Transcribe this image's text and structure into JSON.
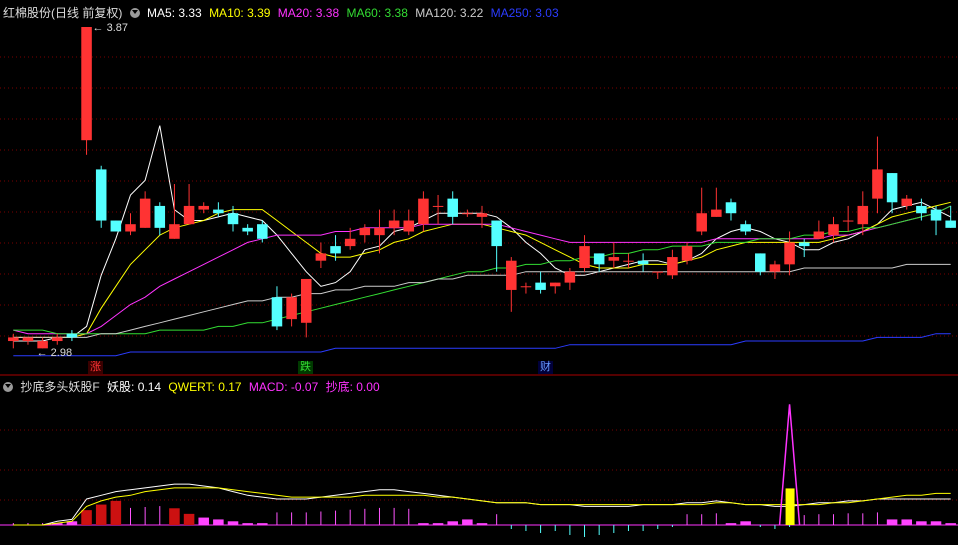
{
  "main_panel": {
    "indicator_icon": "chevron-down-circle-icon",
    "stock_title": "红棉股份(日线 前复权)",
    "ma_legend": [
      {
        "label": "MA5: 3.33",
        "color": "#ffffff"
      },
      {
        "label": "MA10: 3.39",
        "color": "#ffff00"
      },
      {
        "label": "MA20: 3.38",
        "color": "#ff33ff"
      },
      {
        "label": "MA60: 3.38",
        "color": "#33dd33"
      },
      {
        "label": "MA120: 3.22",
        "color": "#cccccc"
      },
      {
        "label": "MA250: 3.03",
        "color": "#2b3cff"
      }
    ],
    "high_label": "3.87",
    "low_label": "2.98",
    "event_tags": [
      {
        "text": "涨",
        "color": "#ff3333"
      },
      {
        "text": "跌",
        "color": "#33dd33"
      },
      {
        "text": "财",
        "color": "#6699ff"
      }
    ]
  },
  "sub_panel": {
    "indicator_icon": "chevron-down-circle-icon",
    "indicator_name": "抄底多头妖股F",
    "values": [
      {
        "label": "妖股: 0.14",
        "color": "#ffffff"
      },
      {
        "label": "QWERT: 0.17",
        "color": "#ffff00"
      },
      {
        "label": "MACD: -0.07",
        "color": "#ff33ff"
      },
      {
        "label": "抄底: 0.00",
        "color": "#ff33ff"
      }
    ]
  },
  "colors": {
    "up": "#ff3333",
    "down": "#54ffff",
    "grid": "#7a0000",
    "background": "#000000"
  },
  "chart_data": {
    "type": "candlestick",
    "title": "红棉股份(日线 前复权)",
    "ylim": [
      2.98,
      3.87
    ],
    "candles": [
      [
        3.01,
        3.02,
        2.99,
        3.03
      ],
      [
        3.01,
        3.02,
        3.0,
        3.02
      ],
      [
        2.99,
        3.01,
        2.99,
        3.02
      ],
      [
        3.01,
        3.02,
        3.0,
        3.03
      ],
      [
        3.03,
        3.02,
        3.01,
        3.04
      ],
      [
        3.56,
        3.87,
        3.52,
        3.87
      ],
      [
        3.48,
        3.34,
        3.32,
        3.49
      ],
      [
        3.34,
        3.31,
        3.31,
        3.34
      ],
      [
        3.31,
        3.33,
        3.3,
        3.36
      ],
      [
        3.32,
        3.4,
        3.32,
        3.42
      ],
      [
        3.38,
        3.32,
        3.3,
        3.39
      ],
      [
        3.29,
        3.33,
        3.29,
        3.44
      ],
      [
        3.33,
        3.38,
        3.33,
        3.44
      ],
      [
        3.37,
        3.38,
        3.36,
        3.39
      ],
      [
        3.37,
        3.36,
        3.35,
        3.39
      ],
      [
        3.36,
        3.33,
        3.31,
        3.38
      ],
      [
        3.32,
        3.31,
        3.3,
        3.33
      ],
      [
        3.33,
        3.29,
        3.28,
        3.34
      ],
      [
        3.13,
        3.05,
        3.04,
        3.16
      ],
      [
        3.07,
        3.13,
        3.05,
        3.14
      ],
      [
        3.06,
        3.18,
        3.02,
        3.18
      ],
      [
        3.23,
        3.25,
        3.21,
        3.28
      ],
      [
        3.27,
        3.25,
        3.23,
        3.3
      ],
      [
        3.27,
        3.29,
        3.26,
        3.32
      ],
      [
        3.3,
        3.32,
        3.28,
        3.33
      ],
      [
        3.3,
        3.32,
        3.25,
        3.37
      ],
      [
        3.32,
        3.34,
        3.3,
        3.37
      ],
      [
        3.31,
        3.34,
        3.3,
        3.37
      ],
      [
        3.33,
        3.4,
        3.31,
        3.42
      ],
      [
        3.38,
        3.38,
        3.33,
        3.41
      ],
      [
        3.4,
        3.35,
        3.33,
        3.42
      ],
      [
        3.36,
        3.36,
        3.35,
        3.37
      ],
      [
        3.35,
        3.36,
        3.32,
        3.38
      ],
      [
        3.34,
        3.27,
        3.2,
        3.34
      ],
      [
        3.15,
        3.23,
        3.09,
        3.24
      ],
      [
        3.16,
        3.16,
        3.14,
        3.17
      ],
      [
        3.17,
        3.15,
        3.14,
        3.2
      ],
      [
        3.16,
        3.17,
        3.14,
        3.17
      ],
      [
        3.17,
        3.2,
        3.15,
        3.21
      ],
      [
        3.21,
        3.27,
        3.2,
        3.3
      ],
      [
        3.25,
        3.22,
        3.2,
        3.25
      ],
      [
        3.23,
        3.24,
        3.21,
        3.28
      ],
      [
        3.23,
        3.23,
        3.21,
        3.25
      ],
      [
        3.23,
        3.22,
        3.2,
        3.25
      ],
      [
        3.2,
        3.2,
        3.18,
        3.2
      ],
      [
        3.19,
        3.24,
        3.18,
        3.26
      ],
      [
        3.23,
        3.27,
        3.22,
        3.28
      ],
      [
        3.31,
        3.36,
        3.3,
        3.43
      ],
      [
        3.35,
        3.37,
        3.35,
        3.43
      ],
      [
        3.39,
        3.36,
        3.34,
        3.4
      ],
      [
        3.33,
        3.31,
        3.3,
        3.34
      ],
      [
        3.25,
        3.2,
        3.19,
        3.25
      ],
      [
        3.2,
        3.22,
        3.18,
        3.23
      ],
      [
        3.22,
        3.28,
        3.19,
        3.31
      ],
      [
        3.28,
        3.27,
        3.24,
        3.29
      ],
      [
        3.29,
        3.31,
        3.29,
        3.34
      ],
      [
        3.3,
        3.33,
        3.28,
        3.35
      ],
      [
        3.34,
        3.34,
        3.31,
        3.38
      ],
      [
        3.33,
        3.38,
        3.3,
        3.42
      ],
      [
        3.4,
        3.48,
        3.36,
        3.57
      ],
      [
        3.47,
        3.39,
        3.36,
        3.47
      ],
      [
        3.38,
        3.4,
        3.37,
        3.41
      ],
      [
        3.38,
        3.36,
        3.34,
        3.4
      ],
      [
        3.37,
        3.34,
        3.3,
        3.38
      ],
      [
        3.34,
        3.32,
        3.32,
        3.38
      ]
    ],
    "moving_averages": [
      {
        "name": "MA5",
        "color": "#ffffff",
        "values": [
          3.01,
          3.01,
          3.01,
          3.02,
          3.02,
          3.05,
          3.19,
          3.29,
          3.41,
          3.45,
          3.6,
          3.37,
          3.34,
          3.34,
          3.35,
          3.36,
          3.35,
          3.34,
          3.3,
          3.25,
          3.2,
          3.16,
          3.17,
          3.2,
          3.26,
          3.27,
          3.31,
          3.32,
          3.34,
          3.36,
          3.36,
          3.36,
          3.36,
          3.35,
          3.32,
          3.28,
          3.25,
          3.21,
          3.19,
          3.19,
          3.2,
          3.21,
          3.22,
          3.23,
          3.23,
          3.22,
          3.23,
          3.25,
          3.29,
          3.31,
          3.32,
          3.31,
          3.29,
          3.28,
          3.26,
          3.26,
          3.28,
          3.29,
          3.31,
          3.33,
          3.37,
          3.38,
          3.39,
          3.37,
          3.35
        ]
      },
      {
        "name": "MA10",
        "color": "#ffff00",
        "values": [
          3.02,
          3.02,
          3.02,
          3.02,
          3.02,
          3.03,
          3.1,
          3.16,
          3.22,
          3.26,
          3.3,
          3.32,
          3.33,
          3.34,
          3.36,
          3.37,
          3.37,
          3.37,
          3.34,
          3.31,
          3.28,
          3.25,
          3.24,
          3.24,
          3.25,
          3.26,
          3.28,
          3.29,
          3.31,
          3.32,
          3.33,
          3.33,
          3.33,
          3.32,
          3.31,
          3.3,
          3.28,
          3.26,
          3.24,
          3.22,
          3.21,
          3.21,
          3.21,
          3.22,
          3.22,
          3.22,
          3.23,
          3.24,
          3.26,
          3.27,
          3.28,
          3.28,
          3.28,
          3.28,
          3.28,
          3.28,
          3.29,
          3.3,
          3.31,
          3.33,
          3.35,
          3.36,
          3.37,
          3.38,
          3.39
        ]
      },
      {
        "name": "MA20",
        "color": "#ff33ff",
        "values": [
          3.04,
          3.03,
          3.03,
          3.03,
          3.03,
          3.03,
          3.05,
          3.08,
          3.11,
          3.13,
          3.16,
          3.18,
          3.2,
          3.22,
          3.24,
          3.26,
          3.28,
          3.29,
          3.3,
          3.3,
          3.3,
          3.3,
          3.31,
          3.31,
          3.32,
          3.32,
          3.32,
          3.32,
          3.33,
          3.33,
          3.33,
          3.33,
          3.33,
          3.33,
          3.32,
          3.31,
          3.3,
          3.29,
          3.28,
          3.28,
          3.28,
          3.28,
          3.28,
          3.28,
          3.28,
          3.28,
          3.28,
          3.28,
          3.29,
          3.29,
          3.29,
          3.29,
          3.29,
          3.29,
          3.29,
          3.29,
          3.3,
          3.3,
          3.31,
          3.32,
          3.33,
          3.34,
          3.35,
          3.36,
          3.38
        ]
      },
      {
        "name": "MA60",
        "color": "#33dd33",
        "values": [
          3.04,
          3.04,
          3.04,
          3.03,
          3.03,
          3.03,
          3.03,
          3.03,
          3.03,
          3.03,
          3.04,
          3.04,
          3.04,
          3.04,
          3.05,
          3.05,
          3.06,
          3.06,
          3.07,
          3.08,
          3.09,
          3.1,
          3.11,
          3.12,
          3.13,
          3.14,
          3.15,
          3.16,
          3.17,
          3.18,
          3.19,
          3.2,
          3.2,
          3.21,
          3.21,
          3.22,
          3.22,
          3.23,
          3.23,
          3.24,
          3.24,
          3.25,
          3.25,
          3.26,
          3.26,
          3.27,
          3.27,
          3.27,
          3.28,
          3.28,
          3.28,
          3.29,
          3.29,
          3.29,
          3.3,
          3.3,
          3.31,
          3.31,
          3.32,
          3.32,
          3.33,
          3.34,
          3.35,
          3.36,
          3.38
        ]
      },
      {
        "name": "MA120",
        "color": "#cccccc",
        "values": [
          3.02,
          3.02,
          3.02,
          3.02,
          3.02,
          3.02,
          3.03,
          3.03,
          3.04,
          3.05,
          3.06,
          3.07,
          3.08,
          3.09,
          3.1,
          3.11,
          3.12,
          3.12,
          3.13,
          3.13,
          3.14,
          3.14,
          3.15,
          3.15,
          3.16,
          3.16,
          3.16,
          3.17,
          3.17,
          3.18,
          3.18,
          3.19,
          3.19,
          3.19,
          3.19,
          3.2,
          3.2,
          3.2,
          3.2,
          3.2,
          3.2,
          3.2,
          3.2,
          3.2,
          3.2,
          3.2,
          3.2,
          3.2,
          3.2,
          3.2,
          3.2,
          3.2,
          3.2,
          3.2,
          3.21,
          3.21,
          3.21,
          3.21,
          3.21,
          3.21,
          3.21,
          3.22,
          3.22,
          3.22,
          3.22
        ]
      },
      {
        "name": "MA250",
        "color": "#2b3cff",
        "values": [
          2.97,
          2.97,
          2.97,
          2.97,
          2.97,
          2.97,
          2.97,
          2.97,
          2.98,
          2.98,
          2.98,
          2.98,
          2.98,
          2.98,
          2.98,
          2.98,
          2.98,
          2.98,
          2.98,
          2.98,
          2.98,
          2.98,
          2.99,
          2.99,
          2.99,
          2.99,
          2.99,
          2.99,
          2.99,
          2.99,
          2.99,
          2.99,
          2.99,
          2.99,
          2.99,
          2.99,
          2.99,
          2.99,
          3.0,
          3.0,
          3.0,
          3.0,
          3.0,
          3.0,
          3.0,
          3.0,
          3.0,
          3.0,
          3.0,
          3.0,
          3.01,
          3.01,
          3.01,
          3.01,
          3.01,
          3.01,
          3.01,
          3.01,
          3.01,
          3.02,
          3.02,
          3.02,
          3.02,
          3.03,
          3.03
        ]
      }
    ],
    "sub_indicator": {
      "ylim": [
        -0.1,
        0.7
      ],
      "bars": [
        0,
        0,
        0,
        0.01,
        0.02,
        0.08,
        0.11,
        0.13,
        0.0,
        0.0,
        0.0,
        0.09,
        0.06,
        0.04,
        0.03,
        0.02,
        0.01,
        0.01,
        0.0,
        0.0,
        0.0,
        0.0,
        0.0,
        0.0,
        0.0,
        0.0,
        0.0,
        0.0,
        0.01,
        0.01,
        0.02,
        0.03,
        0.01,
        0.0,
        0,
        0,
        0,
        0,
        0,
        0,
        0,
        0,
        0,
        0,
        0,
        0,
        0,
        0,
        0,
        0.01,
        0.02,
        0.0,
        0,
        0,
        0,
        0,
        0,
        0,
        0,
        0,
        0.03,
        0.03,
        0.02,
        0.02,
        0.01
      ],
      "neg_bars": [
        0,
        0,
        0,
        0,
        0,
        0,
        0,
        0,
        0,
        0,
        0,
        0,
        0,
        0,
        0,
        0,
        0,
        0,
        0,
        0,
        0,
        0,
        0,
        0,
        0,
        0,
        0,
        0,
        0,
        0,
        0,
        0,
        0,
        0,
        -0.02,
        -0.03,
        -0.04,
        -0.03,
        -0.05,
        -0.06,
        -0.05,
        -0.04,
        -0.03,
        -0.03,
        -0.02,
        -0.01,
        0,
        0,
        0,
        0,
        0,
        -0.01,
        -0.02,
        -0.01,
        0,
        0,
        0,
        0,
        0,
        0,
        0,
        0,
        0,
        0,
        0
      ],
      "yaoguo": [
        0.0,
        0.0,
        0.0,
        0.02,
        0.03,
        0.14,
        0.16,
        0.18,
        0.19,
        0.2,
        0.21,
        0.22,
        0.22,
        0.21,
        0.2,
        0.18,
        0.16,
        0.15,
        0.14,
        0.14,
        0.14,
        0.15,
        0.16,
        0.17,
        0.18,
        0.19,
        0.19,
        0.18,
        0.17,
        0.16,
        0.15,
        0.14,
        0.13,
        0.12,
        0.12,
        0.12,
        0.11,
        0.11,
        0.11,
        0.1,
        0.1,
        0.1,
        0.1,
        0.11,
        0.11,
        0.11,
        0.12,
        0.12,
        0.13,
        0.12,
        0.11,
        0.11,
        0.1,
        0.1,
        0.11,
        0.12,
        0.12,
        0.13,
        0.13,
        0.14,
        0.14,
        0.14,
        0.14,
        0.14,
        0.14
      ],
      "qwert": [
        0.0,
        0.0,
        0.0,
        0.01,
        0.02,
        0.1,
        0.13,
        0.15,
        0.16,
        0.18,
        0.19,
        0.2,
        0.2,
        0.2,
        0.2,
        0.19,
        0.18,
        0.17,
        0.16,
        0.15,
        0.15,
        0.15,
        0.15,
        0.15,
        0.16,
        0.16,
        0.16,
        0.16,
        0.16,
        0.15,
        0.15,
        0.14,
        0.13,
        0.12,
        0.12,
        0.12,
        0.11,
        0.11,
        0.11,
        0.11,
        0.11,
        0.11,
        0.11,
        0.11,
        0.11,
        0.11,
        0.11,
        0.11,
        0.12,
        0.12,
        0.11,
        0.11,
        0.11,
        0.11,
        0.11,
        0.11,
        0.12,
        0.12,
        0.13,
        0.14,
        0.15,
        0.16,
        0.16,
        0.17,
        0.17
      ],
      "spike_index": 53,
      "spike_value": 0.65,
      "yellow_bar_index": 53,
      "yellow_bar_value": 0.17
    }
  }
}
